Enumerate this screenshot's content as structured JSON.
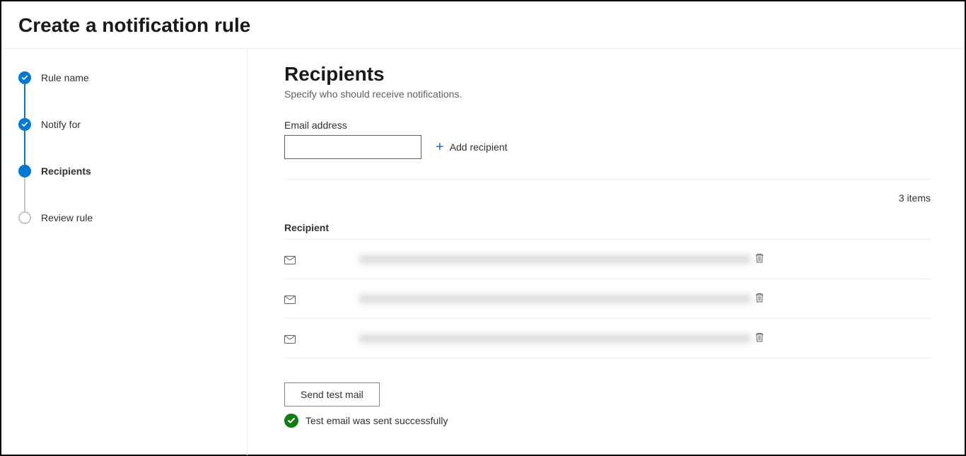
{
  "header": {
    "title": "Create a notification rule"
  },
  "sidebar": {
    "steps": [
      {
        "label": "Rule name",
        "state": "completed"
      },
      {
        "label": "Notify for",
        "state": "completed"
      },
      {
        "label": "Recipients",
        "state": "current"
      },
      {
        "label": "Review rule",
        "state": "upcoming"
      }
    ]
  },
  "main": {
    "heading": "Recipients",
    "subtitle": "Specify who should receive notifications.",
    "email_label": "Email address",
    "email_value": "",
    "add_recipient_label": "Add recipient",
    "items_count": "3 items",
    "table_header": "Recipient",
    "recipients": [
      {
        "email": ""
      },
      {
        "email": ""
      },
      {
        "email": ""
      }
    ],
    "send_test_label": "Send test mail",
    "status_message": "Test email was sent successfully"
  }
}
